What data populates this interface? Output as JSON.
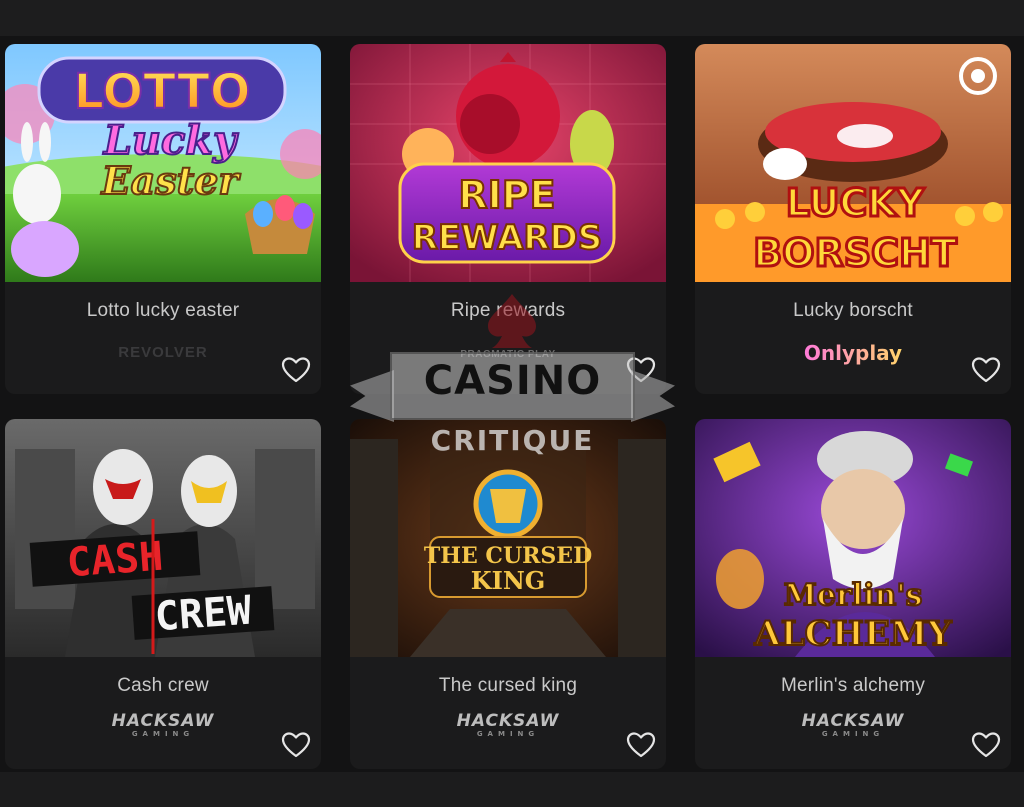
{
  "games": [
    {
      "title": "Lotto lucky easter",
      "provider": "REVOLVER",
      "art_text": [
        "LOTTO",
        "Lucky",
        "Easter"
      ]
    },
    {
      "title": "Ripe rewards",
      "provider": "PRAGMATIC PLAY",
      "art_text": [
        "RIPE",
        "REWARDS"
      ]
    },
    {
      "title": "Lucky borscht",
      "provider": "Onlyplay",
      "art_text": [
        "LUCKY",
        "BORSCHT"
      ]
    },
    {
      "title": "Cash crew",
      "provider": "HACKSAW",
      "provider_sub": "GAMING",
      "art_text": [
        "CASH",
        "CREW"
      ]
    },
    {
      "title": "The cursed king",
      "provider": "HACKSAW",
      "provider_sub": "GAMING",
      "art_text": [
        "THE CURSED",
        "KING"
      ]
    },
    {
      "title": "Merlin's alchemy",
      "provider": "HACKSAW",
      "provider_sub": "GAMING",
      "art_text": [
        "Merlin's",
        "ALCHEMY"
      ]
    }
  ],
  "watermark": {
    "line1": "CASINO",
    "line2": "CRITIQUE"
  },
  "icons": {
    "favorite": "heart-outline-icon",
    "demo": "radio-dot-icon"
  }
}
